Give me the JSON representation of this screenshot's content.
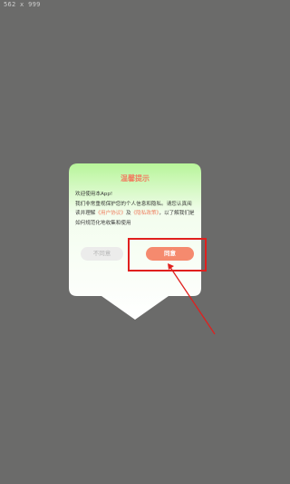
{
  "dimension_label": "562 x 999",
  "dialog": {
    "title": "温馨提示",
    "line1": "欢迎使用本App!",
    "line2_prefix": "我们非常重视保护您的个人信息和隐私。请您认真阅读并理解",
    "user_agreement": "《用户协议》",
    "conjunction": "及",
    "privacy_policy": "《隐私政策》",
    "line2_suffix": "，以了解我们是如何规范化地收集和使用",
    "disagree_label": "不同意",
    "agree_label": "同意"
  },
  "colors": {
    "overlay": "#6b6b6a",
    "accent": "#f07f62",
    "agree_button": "#f58a6e",
    "highlight_box": "#e0201e",
    "gradient_top": "#b8f59a",
    "gradient_bottom": "#ffffff"
  }
}
